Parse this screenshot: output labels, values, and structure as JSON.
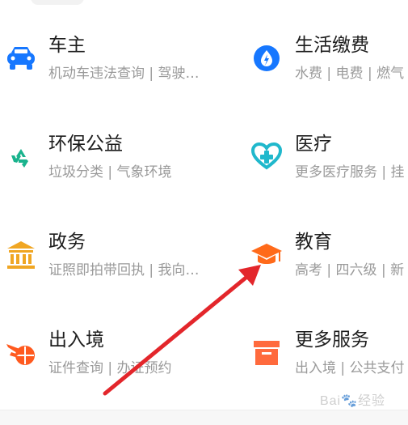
{
  "services": {
    "items": [
      {
        "id": "owner",
        "title": "车主",
        "subtitle": "机动车违法查询 | 驾驶…",
        "icon": "car-icon",
        "color": "#1677ff"
      },
      {
        "id": "living",
        "title": "生活缴费",
        "subtitle": "水费 | 电费 | 燃气",
        "icon": "water-drop-icon",
        "color": "#1677ff"
      },
      {
        "id": "env",
        "title": "环保公益",
        "subtitle": "垃圾分类 | 气象环境",
        "icon": "recycle-icon",
        "color": "#19b38d"
      },
      {
        "id": "medical",
        "title": "医疗",
        "subtitle": "更多医疗服务 | 挂",
        "icon": "medical-heart-icon",
        "color": "#20b8cc"
      },
      {
        "id": "gov",
        "title": "政务",
        "subtitle": "证照即拍带回执 | 我向…",
        "icon": "government-building-icon",
        "color": "#f0a623"
      },
      {
        "id": "edu",
        "title": "教育",
        "subtitle": "高考 | 四六级 | 新",
        "icon": "graduation-cap-icon",
        "color": "#ff6a1a"
      },
      {
        "id": "border",
        "title": "出入境",
        "subtitle": "证件查询 | 办证预约",
        "icon": "plane-globe-icon",
        "color": "#ff5a1f"
      },
      {
        "id": "more",
        "title": "更多服务",
        "subtitle": "出入境 | 公共支付",
        "icon": "box-icon",
        "color": "#ff6a3d"
      }
    ]
  },
  "annotation": {
    "arrow_color": "#e3262b"
  },
  "watermark": {
    "text": "Bai🐾经验"
  }
}
